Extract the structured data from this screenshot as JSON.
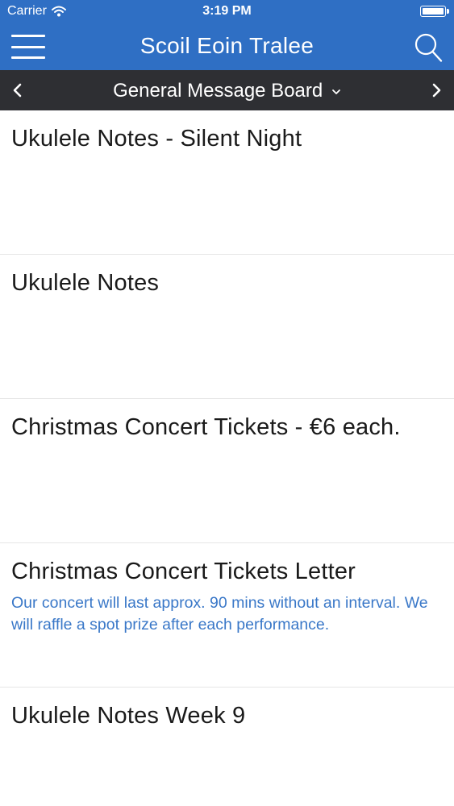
{
  "status_bar": {
    "carrier": "Carrier",
    "time": "3:19 PM"
  },
  "header": {
    "title": "Scoil Eoin Tralee",
    "menu_icon": "hamburger-icon",
    "search_icon": "search-icon",
    "background_color": "#2f6fc4"
  },
  "board_bar": {
    "label": "General Message Board",
    "prev_icon": "chevron-left-icon",
    "next_icon": "chevron-right-icon",
    "background_color": "#2e2f33"
  },
  "messages": [
    {
      "title": "Ukulele Notes - Silent Night",
      "snippet": ""
    },
    {
      "title": "Ukulele Notes",
      "snippet": ""
    },
    {
      "title": "Christmas Concert Tickets  - €6 each.",
      "snippet": ""
    },
    {
      "title": "Christmas Concert Tickets Letter",
      "snippet": "Our concert will last approx. 90 mins without an interval.   We will raffle a spot prize after each performance."
    },
    {
      "title": "Ukulele Notes Week 9",
      "snippet": ""
    }
  ],
  "colors": {
    "link_text": "#3a78c8"
  }
}
